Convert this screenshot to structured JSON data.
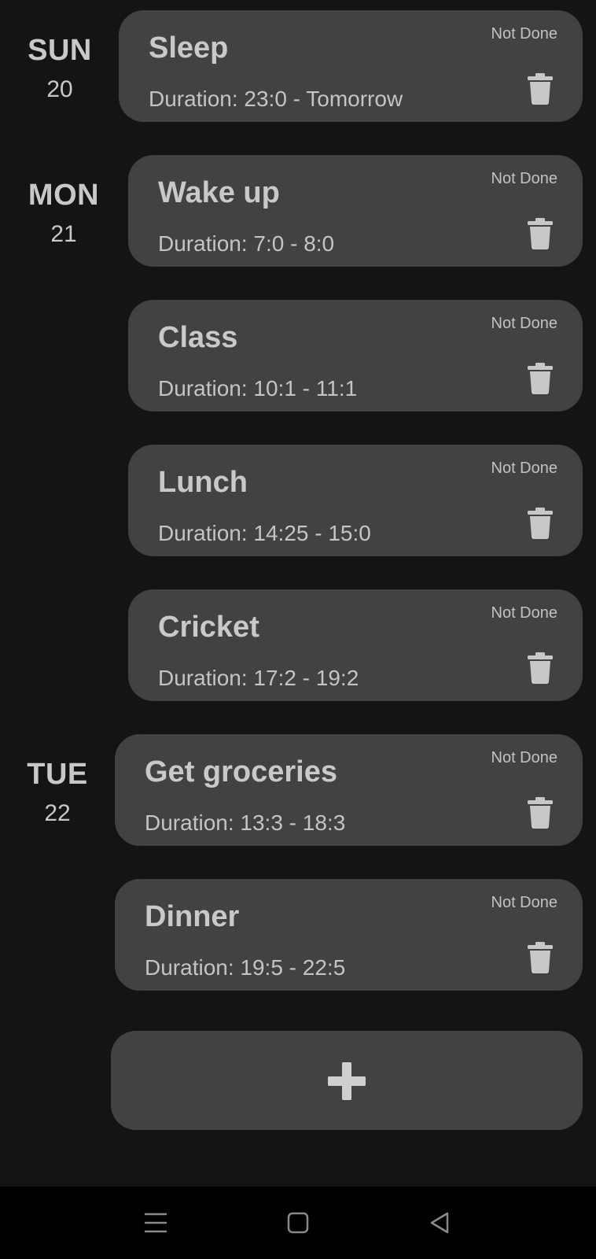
{
  "days": [
    {
      "dow": "SUN",
      "dom": "20"
    },
    {
      "dow": "MON",
      "dom": "21"
    },
    {
      "dow": "TUE",
      "dom": "22"
    }
  ],
  "tasks": [
    {
      "title": "Sleep",
      "duration": "Duration: 23:0 - Tomorrow",
      "status": "Not Done"
    },
    {
      "title": "Wake up",
      "duration": "Duration: 7:0 - 8:0",
      "status": "Not Done"
    },
    {
      "title": "Class",
      "duration": "Duration: 10:1 - 11:1",
      "status": "Not Done"
    },
    {
      "title": "Lunch",
      "duration": "Duration: 14:25 - 15:0",
      "status": "Not Done"
    },
    {
      "title": "Cricket",
      "duration": "Duration: 17:2 - 19:2",
      "status": "Not Done"
    },
    {
      "title": "Get groceries",
      "duration": "Duration: 13:3 - 18:3",
      "status": "Not Done"
    },
    {
      "title": "Dinner",
      "duration": "Duration: 19:5 - 22:5",
      "status": "Not Done"
    }
  ],
  "icons": {
    "delete": "trash-icon",
    "add": "plus-icon",
    "nav_menu": "menu-icon",
    "nav_home": "home-icon",
    "nav_back": "back-icon"
  },
  "colors": {
    "background": "#141414",
    "card": "#424242",
    "text": "#c8c8c8",
    "navbar": "#000000"
  }
}
